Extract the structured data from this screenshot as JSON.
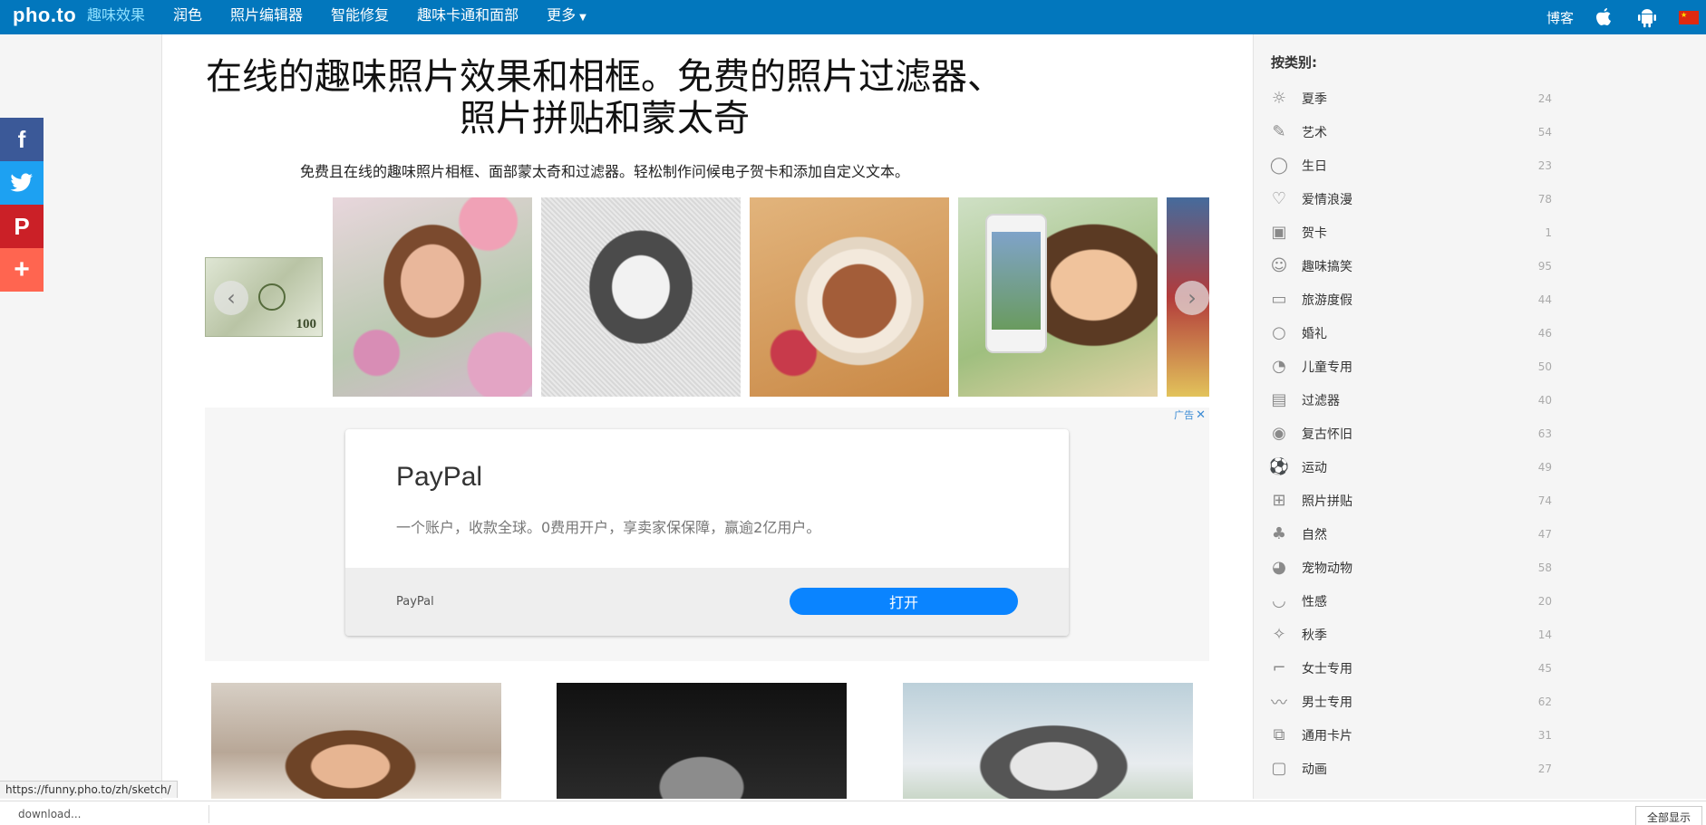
{
  "header": {
    "logo": "pho.to",
    "nav": [
      {
        "label": "趣味效果",
        "active": true
      },
      {
        "label": "润色",
        "active": false
      },
      {
        "label": "照片编辑器",
        "active": false
      },
      {
        "label": "智能修复",
        "active": false
      },
      {
        "label": "趣味卡通和面部",
        "active": false
      },
      {
        "label": "更多",
        "active": false
      }
    ],
    "blog": "博客",
    "platform_icons": [
      "apple-icon",
      "android-icon"
    ],
    "language_flag": "china-flag-icon",
    "bar_color": "#0277bd"
  },
  "share": {
    "facebook": "f",
    "twitter": "twitter-bird-icon",
    "pinterest": "P",
    "more": "+"
  },
  "main": {
    "title": "在线的趣味照片效果和相框。免费的照片过滤器、照片拼贴和蒙太奇",
    "subtitle": "免费且在线的趣味照片相框、面部蒙太奇和过滤器。轻松制作问候电子贺卡和添加自定义文本。"
  },
  "ad": {
    "badge": "广告",
    "brand": "PayPal",
    "description": "一个账户，收款全球。0费用开户，享卖家保保障，赢逾2亿用户。",
    "footer_brand": "PayPal",
    "cta": "打开"
  },
  "sidebar": {
    "title": "按类别:",
    "categories": [
      {
        "label": "夏季",
        "count": "24",
        "icon": "sun-icon"
      },
      {
        "label": "艺术",
        "count": "54",
        "icon": "brush-icon"
      },
      {
        "label": "生日",
        "count": "23",
        "icon": "balloon-icon"
      },
      {
        "label": "爱情浪漫",
        "count": "78",
        "icon": "heart-icon"
      },
      {
        "label": "贺卡",
        "count": "1",
        "icon": "card-icon"
      },
      {
        "label": "趣味搞笑",
        "count": "95",
        "icon": "smile-icon"
      },
      {
        "label": "旅游度假",
        "count": "44",
        "icon": "suitcase-icon"
      },
      {
        "label": "婚礼",
        "count": "46",
        "icon": "ring-icon"
      },
      {
        "label": "儿童专用",
        "count": "50",
        "icon": "duck-icon"
      },
      {
        "label": "过滤器",
        "count": "40",
        "icon": "film-icon"
      },
      {
        "label": "复古怀旧",
        "count": "63",
        "icon": "retro-icon"
      },
      {
        "label": "运动",
        "count": "49",
        "icon": "ball-icon"
      },
      {
        "label": "照片拼贴",
        "count": "74",
        "icon": "collage-icon"
      },
      {
        "label": "自然",
        "count": "47",
        "icon": "tree-icon"
      },
      {
        "label": "宠物动物",
        "count": "58",
        "icon": "pet-icon"
      },
      {
        "label": "性感",
        "count": "20",
        "icon": "lips-icon"
      },
      {
        "label": "秋季",
        "count": "14",
        "icon": "leaf-icon"
      },
      {
        "label": "女士专用",
        "count": "45",
        "icon": "heel-icon"
      },
      {
        "label": "男士专用",
        "count": "62",
        "icon": "mustache-icon"
      },
      {
        "label": "通用卡片",
        "count": "31",
        "icon": "cards-icon"
      },
      {
        "label": "动画",
        "count": "27",
        "icon": "speech-icon"
      }
    ]
  },
  "carousel": {
    "bill_label": "100"
  },
  "status": {
    "url": "https://funny.pho.to/zh/sketch/",
    "download_file": "download...",
    "show_all": "全部显示"
  }
}
